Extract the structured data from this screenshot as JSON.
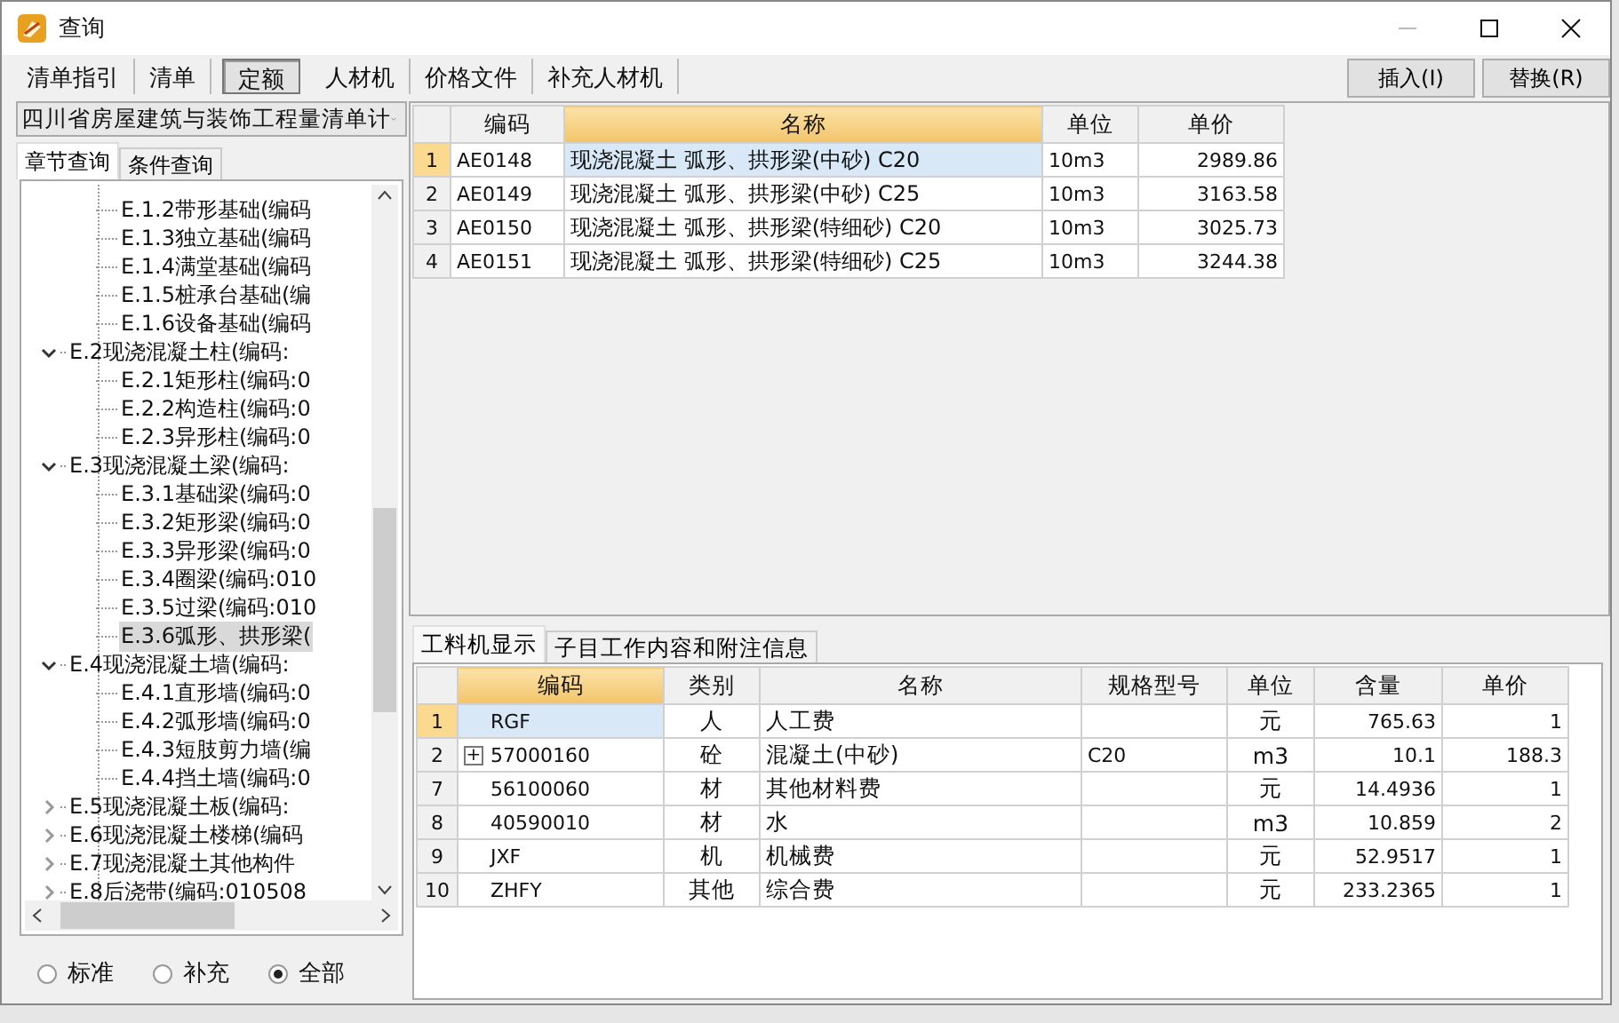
{
  "window": {
    "title": "查询"
  },
  "toolbar_tabs": [
    {
      "label": "清单指引",
      "selected": false
    },
    {
      "label": "清单",
      "selected": false
    },
    {
      "label": "定额",
      "selected": true
    },
    {
      "label": "人材机",
      "selected": false
    },
    {
      "label": "价格文件",
      "selected": false
    },
    {
      "label": "补充人材机",
      "selected": false
    }
  ],
  "buttons": [
    "插入(I)",
    "替换(R)"
  ],
  "library_select": {
    "value": "四川省房屋建筑与装饰工程量清单计"
  },
  "side_tabs": [
    {
      "label": "章节查询",
      "selected": true
    },
    {
      "label": "条件查询",
      "selected": false
    }
  ],
  "tree": {
    "continued_children": [
      {
        "label": "E.1.2带形基础(编码",
        "selected": false
      },
      {
        "label": "E.1.3独立基础(编码",
        "selected": false
      },
      {
        "label": "E.1.4满堂基础(编码",
        "selected": false
      },
      {
        "label": "E.1.5桩承台基础(编",
        "selected": false
      },
      {
        "label": "E.1.6设备基础(编码",
        "selected": false
      }
    ],
    "items": [
      {
        "label": "E.2现浇混凝土柱(编码:",
        "selected": false,
        "expanded": true,
        "children": [
          {
            "label": "E.2.1矩形柱(编码:0",
            "selected": false
          },
          {
            "label": "E.2.2构造柱(编码:0",
            "selected": false
          },
          {
            "label": "E.2.3异形柱(编码:0",
            "selected": false
          }
        ]
      },
      {
        "label": "E.3现浇混凝土梁(编码:",
        "selected": false,
        "expanded": true,
        "children": [
          {
            "label": "E.3.1基础梁(编码:0",
            "selected": false
          },
          {
            "label": "E.3.2矩形梁(编码:0",
            "selected": false
          },
          {
            "label": "E.3.3异形梁(编码:0",
            "selected": false
          },
          {
            "label": "E.3.4圈梁(编码:010",
            "selected": false
          },
          {
            "label": "E.3.5过梁(编码:010",
            "selected": false
          },
          {
            "label": "E.3.6弧形、拱形梁(",
            "selected": true
          }
        ]
      },
      {
        "label": "E.4现浇混凝土墙(编码:",
        "selected": false,
        "expanded": true,
        "children": [
          {
            "label": "E.4.1直形墙(编码:0",
            "selected": false
          },
          {
            "label": "E.4.2弧形墙(编码:0",
            "selected": false
          },
          {
            "label": "E.4.3短肢剪力墙(编",
            "selected": false
          },
          {
            "label": "E.4.4挡土墙(编码:0",
            "selected": false
          }
        ]
      },
      {
        "label": "E.5现浇混凝土板(编码:",
        "selected": false,
        "expanded": false
      },
      {
        "label": "E.6现浇混凝土楼梯(编码",
        "selected": false,
        "expanded": false
      },
      {
        "label": "E.7现浇混凝土其他构件",
        "selected": false,
        "expanded": false
      },
      {
        "label": "E.8后浇带(编码:010508",
        "selected": false,
        "expanded": false
      }
    ]
  },
  "filter_radios": [
    {
      "label": "标准",
      "selected": false
    },
    {
      "label": "补充",
      "selected": false
    },
    {
      "label": "全部",
      "selected": true
    }
  ],
  "quota_table": {
    "columns": [
      {
        "label": "编码",
        "selected": false
      },
      {
        "label": "名称",
        "selected": true
      },
      {
        "label": "单位",
        "selected": false
      },
      {
        "label": "单价",
        "selected": false
      }
    ],
    "rows": [
      {
        "index": "1",
        "selected": true,
        "cells": [
          "AE0148",
          "现浇混凝土 弧形、拱形梁(中砂) C20",
          "10m3",
          "2989.86"
        ]
      },
      {
        "index": "2",
        "selected": false,
        "cells": [
          "AE0149",
          "现浇混凝土 弧形、拱形梁(中砂) C25",
          "10m3",
          "3163.58"
        ]
      },
      {
        "index": "3",
        "selected": false,
        "cells": [
          "AE0150",
          "现浇混凝土 弧形、拱形梁(特细砂) C20",
          "10m3",
          "3025.73"
        ]
      },
      {
        "index": "4",
        "selected": false,
        "cells": [
          "AE0151",
          "现浇混凝土 弧形、拱形梁(特细砂) C25",
          "10m3",
          "3244.38"
        ]
      }
    ]
  },
  "detail_tabs": [
    {
      "label": "工料机显示",
      "selected": true
    },
    {
      "label": "子目工作内容和附注信息",
      "selected": false
    }
  ],
  "resource_table": {
    "columns": [
      {
        "label": "编码",
        "selected": true
      },
      {
        "label": "类别",
        "selected": false
      },
      {
        "label": "名称",
        "selected": false
      },
      {
        "label": "规格型号",
        "selected": false
      },
      {
        "label": "单位",
        "selected": false
      },
      {
        "label": "含量",
        "selected": false
      },
      {
        "label": "单价",
        "selected": false
      }
    ],
    "rows": [
      {
        "index": "1",
        "selected": true,
        "cells": [
          "RGF",
          "人",
          "人工费",
          "",
          "元",
          "765.63",
          "1"
        ]
      },
      {
        "index": "2",
        "selected": false,
        "expander": "+",
        "cells": [
          "57000160",
          "砼",
          "混凝土(中砂)",
          "C20",
          "m3",
          "10.1",
          "188.3"
        ]
      },
      {
        "index": "7",
        "selected": false,
        "cells": [
          "56100060",
          "材",
          "其他材料费",
          "",
          "元",
          "14.4936",
          "1"
        ]
      },
      {
        "index": "8",
        "selected": false,
        "cells": [
          "40590010",
          "材",
          "水",
          "",
          "m3",
          "10.859",
          "2"
        ]
      },
      {
        "index": "9",
        "selected": false,
        "cells": [
          "JXF",
          "机",
          "机械费",
          "",
          "元",
          "52.9517",
          "1"
        ]
      },
      {
        "index": "10",
        "selected": false,
        "cells": [
          "ZHFY",
          "其他",
          "综合费",
          "",
          "元",
          "233.2365",
          "1"
        ]
      }
    ]
  }
}
